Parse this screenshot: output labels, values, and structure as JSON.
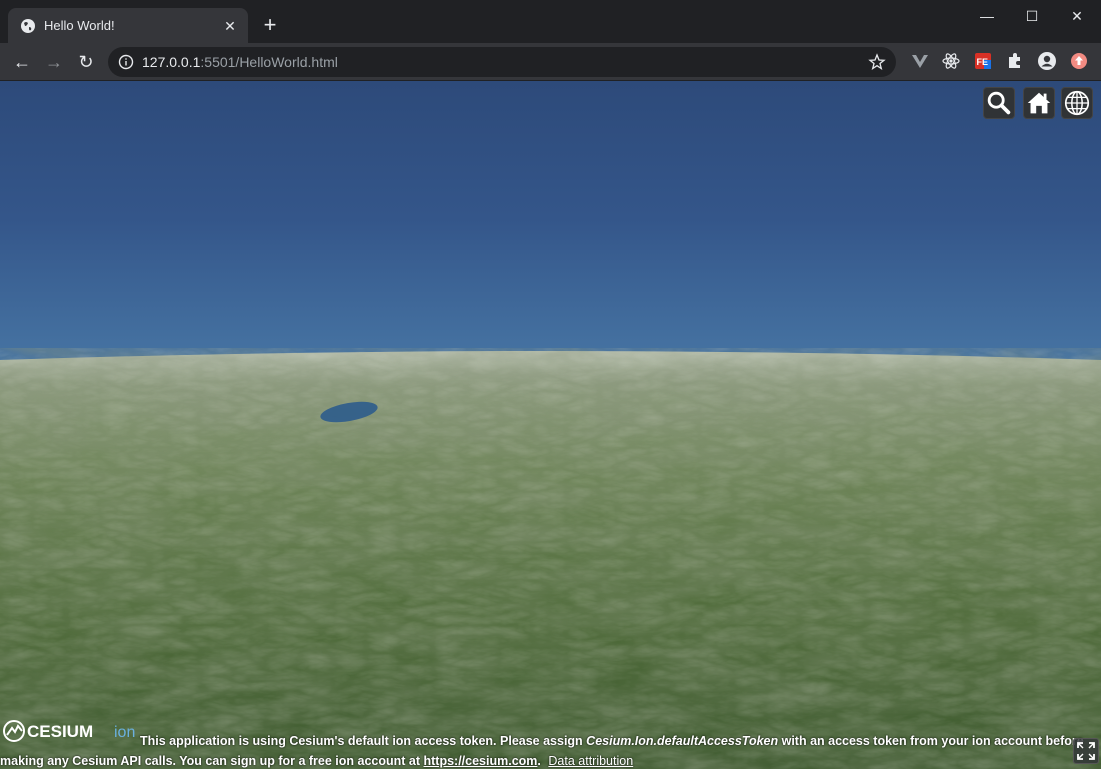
{
  "browser": {
    "tab_title": "Hello World!",
    "tab_icon": "globe-icon",
    "url_host": "127.0.0.1",
    "url_rest": ":5501/HelloWorld.html",
    "window_controls": [
      "minimize",
      "maximize",
      "close"
    ],
    "extensions": [
      "vue-devtools-icon",
      "react-devtools-icon",
      "fe-helper-icon",
      "puzzle-icon",
      "profile-icon",
      "update-icon"
    ]
  },
  "cesium": {
    "toolbar_buttons": [
      "search-icon",
      "home-icon",
      "globe-icon"
    ],
    "logo_text": "CESIUM",
    "logo_suffix": "ion",
    "credit_part1": "This application is using Cesium's default ion access token. Please assign ",
    "credit_code": "Cesium.Ion.defaultAccessToken",
    "credit_part2": " with an access token from your ion account before making any Cesium API calls. You can sign up for a free ion account at ",
    "credit_link": "https://cesium.com",
    "credit_period": ".",
    "data_attribution": "Data attribution"
  },
  "colors": {
    "sky_top": "#2d4a7a",
    "horizon": "#dfeaef",
    "terrain": "#4f6b3a",
    "chrome_dark": "#202124",
    "chrome_toolbar": "#35363a"
  }
}
